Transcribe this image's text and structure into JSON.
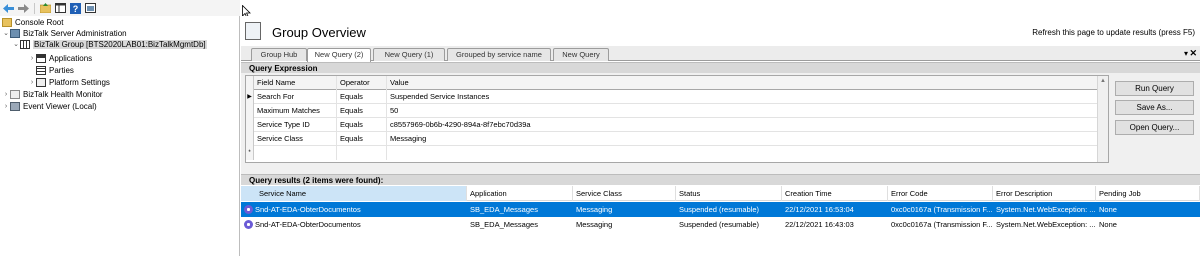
{
  "toolbar": {
    "buttons": [
      "back-icon",
      "forward-icon",
      "up-folder-icon",
      "show-hide-tree-icon",
      "help-icon",
      "properties-icon"
    ]
  },
  "tree": {
    "items": [
      {
        "label": "Console Root",
        "icon": "folder-icon",
        "level": 0,
        "arrow": ""
      },
      {
        "label": "BizTalk Server Administration",
        "icon": "server-icon",
        "level": 0,
        "arrow": "expanded"
      },
      {
        "label": "BizTalk Group [BTS2020LAB01:BizTalkMgmtDb]",
        "icon": "group-icon",
        "level": 1,
        "arrow": "expanded",
        "selected": true
      },
      {
        "label": "Applications",
        "icon": "applications-icon",
        "level": 2,
        "arrow": "collapsed"
      },
      {
        "label": "Parties",
        "icon": "parties-icon",
        "level": 2,
        "arrow": ""
      },
      {
        "label": "Platform Settings",
        "icon": "platform-settings-icon",
        "level": 2,
        "arrow": "collapsed"
      },
      {
        "label": "BizTalk Health Monitor",
        "icon": "health-monitor-icon",
        "level": 0,
        "arrow": "collapsed"
      },
      {
        "label": "Event Viewer (Local)",
        "icon": "event-viewer-icon",
        "level": 0,
        "arrow": "collapsed"
      }
    ]
  },
  "header": {
    "title": "Group Overview",
    "refresh_note": "Refresh this page to update results (press F5)"
  },
  "tabs": [
    {
      "label": "Group Hub",
      "active": false
    },
    {
      "label": "New Query (2)",
      "active": true
    },
    {
      "label": "New Query (1)",
      "active": false
    },
    {
      "label": "Grouped by service name",
      "active": false
    },
    {
      "label": "New Query",
      "active": false
    }
  ],
  "query_expression": {
    "header": "Query Expression",
    "columns": [
      "Field Name",
      "Operator",
      "Value"
    ],
    "rows": [
      {
        "field": "Search For",
        "operator": "Equals",
        "value": "Suspended Service Instances",
        "current": true
      },
      {
        "field": "Maximum Matches",
        "operator": "Equals",
        "value": "50"
      },
      {
        "field": "Service Type ID",
        "operator": "Equals",
        "value": "c8557969-0b6b-4290-894a-8f7ebc70d39a"
      },
      {
        "field": "Service Class",
        "operator": "Equals",
        "value": "Messaging"
      },
      {
        "field": "",
        "operator": "",
        "value": "",
        "new_row": true
      }
    ],
    "new_row_marker": "*",
    "current_row_marker": "▶"
  },
  "buttons": {
    "run_query": "Run Query",
    "save_as": "Save As...",
    "open_query": "Open Query..."
  },
  "results": {
    "header": "Query results (2 items were found):",
    "columns": [
      "Service Name",
      "Application",
      "Service Class",
      "Status",
      "Creation Time",
      "Error Code",
      "Error Description",
      "Pending Job"
    ],
    "rows": [
      {
        "service_name": "Snd-AT-EDA-ObterDocumentos",
        "application": "SB_EDA_Messages",
        "service_class": "Messaging",
        "status": "Suspended (resumable)",
        "creation_time": "22/12/2021 16:53:04",
        "error_code": "0xc0c0167a (Transmission F...",
        "error_description": "System.Net.WebException: ...",
        "pending_job": "None",
        "selected": true
      },
      {
        "service_name": "Snd-AT-EDA-ObterDocumentos",
        "application": "SB_EDA_Messages",
        "service_class": "Messaging",
        "status": "Suspended (resumable)",
        "creation_time": "22/12/2021 16:43:03",
        "error_code": "0xc0c0167a (Transmission F...",
        "error_description": "System.Net.WebException: ...",
        "pending_job": "None",
        "selected": false
      }
    ]
  },
  "colors": {
    "selection": "#0078d7",
    "tab_strip": "#ececec",
    "section_header": "#d8d8d8"
  }
}
